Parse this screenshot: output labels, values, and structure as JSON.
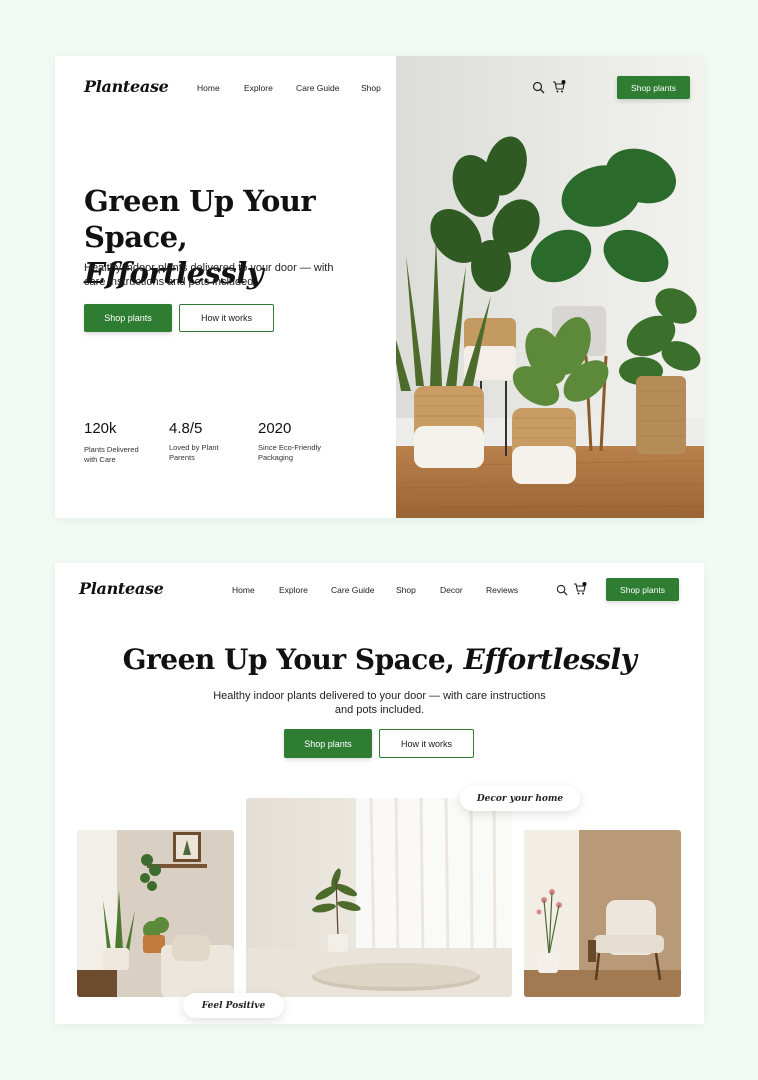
{
  "brand": "Plantease",
  "nav": [
    "Home",
    "Explore",
    "Care Guide",
    "Shop",
    "Decor",
    "Reviews"
  ],
  "cart_badge": "0",
  "header_cta": "Shop plants",
  "hero": {
    "title_part1": "Green Up Your Space,",
    "title_part2": "Effortlessly",
    "subtitle_v1_line1": "Healthy indoor plants delivered to your door — with",
    "subtitle_v1_line2": "care instructions and pots included.",
    "subtitle_v2_line1": "Healthy indoor plants delivered to your door — with care instructions",
    "subtitle_v2_line2": "and pots included.",
    "primary_cta": "Shop plants",
    "secondary_cta": "How it works"
  },
  "stats": [
    {
      "value": "120k",
      "label_line1": "Plants Delivered",
      "label_line2": "with Care"
    },
    {
      "value": "4.8/5",
      "label_line1": "Loved by Plant",
      "label_line2": "Parents"
    },
    {
      "value": "2020",
      "label_line1": "Since Eco-Friendly",
      "label_line2": "Packaging"
    }
  ],
  "gallery_tags": {
    "decor": "Decor your home",
    "positive": "Feel Positive"
  },
  "colors": {
    "accent": "#2e7d32",
    "page_background": "#f1fbf4"
  }
}
